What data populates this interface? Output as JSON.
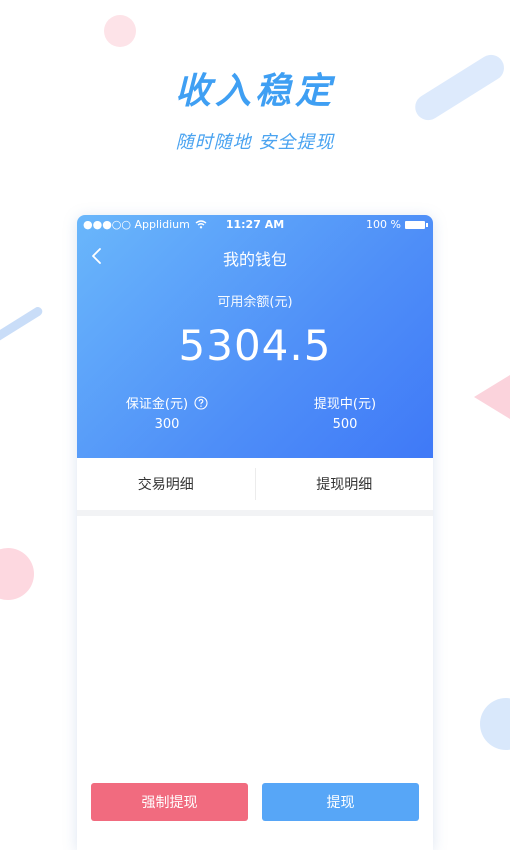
{
  "hero": {
    "title": "收入稳定",
    "subtitle": "随时随地 安全提现"
  },
  "status_bar": {
    "carrier": "●●●○○ Applidium",
    "time": "11:27 AM",
    "battery": "100 %"
  },
  "nav": {
    "title": "我的钱包"
  },
  "balance": {
    "label": "可用余额(元)",
    "value": "5304.5"
  },
  "deposit": {
    "label": "保证金(元)",
    "value": "300"
  },
  "withdrawing": {
    "label": "提现中(元)",
    "value": "500"
  },
  "tabs": [
    {
      "label": "交易明细"
    },
    {
      "label": "提现明细"
    }
  ],
  "buttons": {
    "force_withdraw": "强制提现",
    "withdraw": "提现"
  },
  "colors": {
    "accent_blue": "#4f8ff8",
    "danger_pink": "#f16b7f",
    "button_blue": "#57a6f7"
  },
  "icons": [
    "back-arrow-icon",
    "wifi-icon",
    "battery-icon",
    "help-icon"
  ]
}
